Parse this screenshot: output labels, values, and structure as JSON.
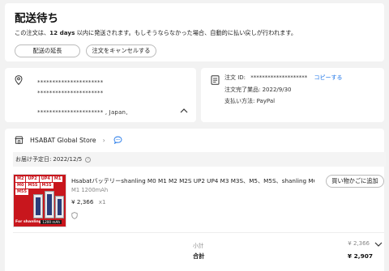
{
  "status": {
    "title": "配送待ち",
    "notice_prefix": "この注文は、",
    "notice_days": "12 days",
    "notice_suffix": " 以内に発送されます。もしそうならなかった場合、自動的に払い戻しが行われます。",
    "extend_button": "配送の延長",
    "cancel_button": "注文をキャンセルする"
  },
  "address": {
    "line1": "**********************",
    "line2": "**********************",
    "line3": "**********************  , Japan,"
  },
  "order_info": {
    "order_id_label": "注文 ID:",
    "order_id_value": "********************",
    "copy_link": "コピーする",
    "completed_label": "注文完了業品:",
    "completed_date": "2022/9/30",
    "payment_label": "支払い方法:",
    "payment_method": "PayPal"
  },
  "store": {
    "name": "HSABAT Global Store"
  },
  "delivery": {
    "label": "お届け予定日:",
    "date": "2022/12/5"
  },
  "product": {
    "thumb_tags": [
      "M2",
      "UP2",
      "UP4",
      "M1",
      "M0",
      "M5S",
      "M3S",
      "M55"
    ],
    "thumb_brand": "For shanling",
    "thumb_capacity": "1200 mAh",
    "title": "Hsabatバッテリーshanling M0 M1 M2 M2S UP2 UP4 M3 M3S、M5、M5S、shanling M6 ...",
    "variant": "M1 1200mAh",
    "price": "¥ 2,366",
    "qty": "x1",
    "rebuy_button": "買い物かごに追加"
  },
  "summary": {
    "subtotal_label": "小計",
    "subtotal_value": "¥ 2,366",
    "total_label": "合計",
    "total_value": "¥ 2,907"
  }
}
